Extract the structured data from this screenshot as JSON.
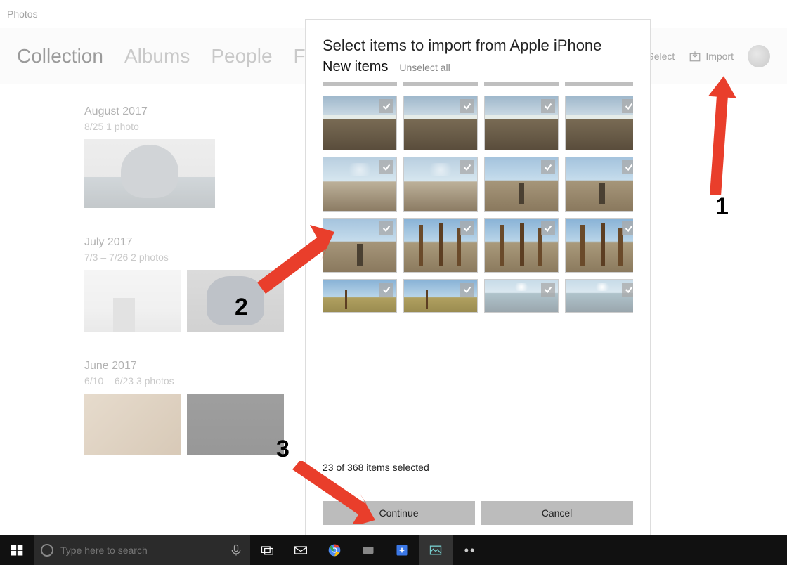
{
  "titlebar": {
    "app_name": "Photos"
  },
  "header": {
    "tabs": {
      "collection": "Collection",
      "albums": "Albums",
      "people": "People",
      "folders": "Folders"
    },
    "select_label": "Select",
    "import_label": "Import"
  },
  "groups": {
    "g0": {
      "title": "August 2017",
      "subtitle": "8/25   1 photo"
    },
    "g1": {
      "title": "July 2017",
      "subtitle": "7/3 – 7/26   2 photos"
    },
    "g2": {
      "title": "June 2017",
      "subtitle": "6/10 – 6/23   3 photos"
    }
  },
  "dialog": {
    "title": "Select items to import from Apple iPhone",
    "section_label": "New items",
    "unselect_label": "Unselect all",
    "status": "23 of 368 items selected",
    "continue_label": "Continue",
    "cancel_label": "Cancel"
  },
  "taskbar": {
    "search_placeholder": "Type here to search"
  },
  "annotations": {
    "a1": "1",
    "a2": "2",
    "a3": "3"
  }
}
